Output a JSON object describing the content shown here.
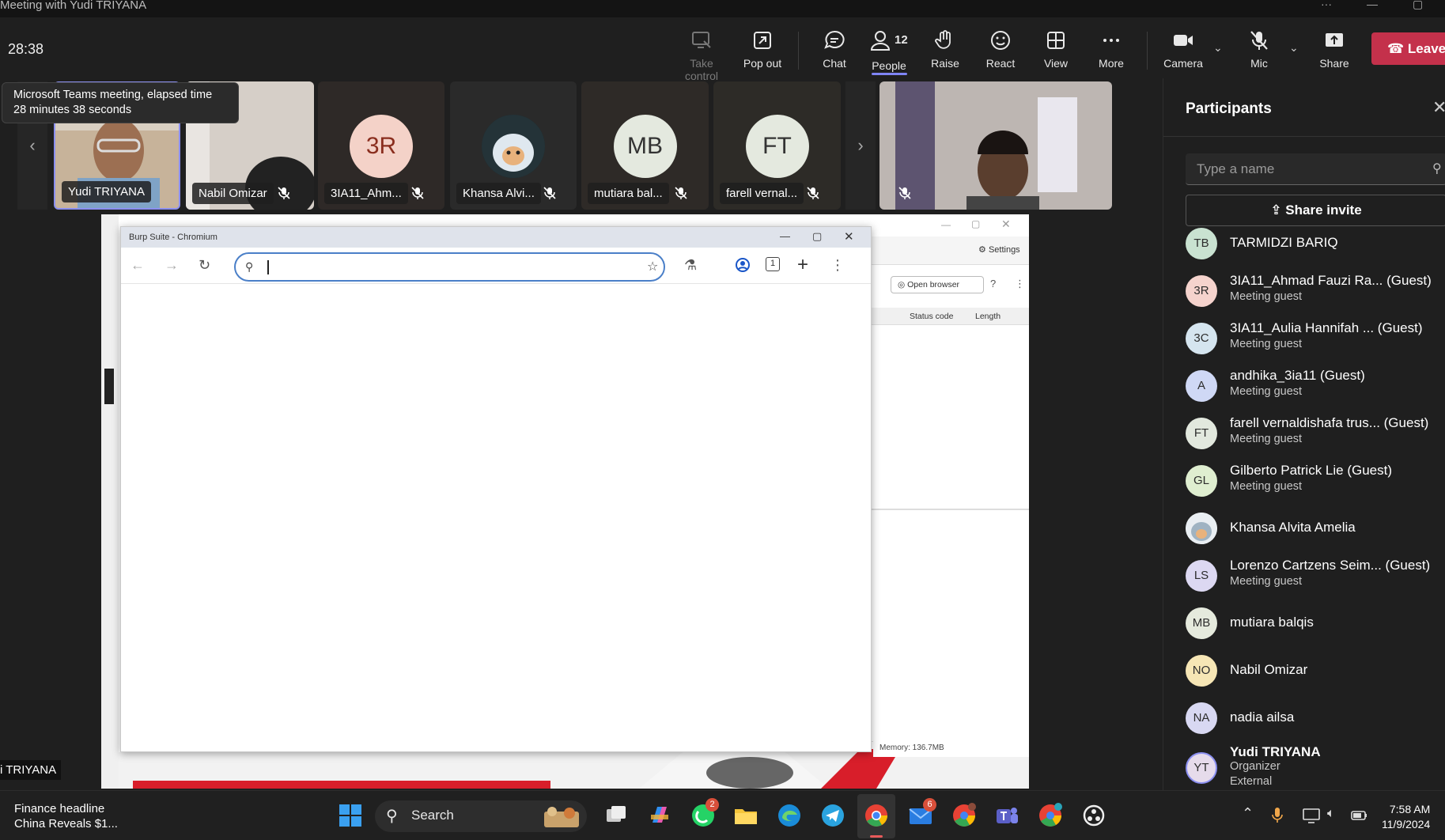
{
  "window": {
    "title": "Meeting with Yudi TRIYANA"
  },
  "toolbar": {
    "timer": "28:38",
    "take_control": "Take control",
    "pop_out": "Pop out",
    "chat": "Chat",
    "people": "People",
    "people_count": "12",
    "raise": "Raise",
    "react": "React",
    "view": "View",
    "more": "More",
    "camera": "Camera",
    "mic": "Mic",
    "share": "Share",
    "leave": "Leave"
  },
  "tooltip": {
    "line1": "Microsoft Teams meeting, elapsed time",
    "line2": "28 minutes 38 seconds"
  },
  "tiles": [
    {
      "name": "Yudi TRIYANA"
    },
    {
      "name": "Nabil Omizar"
    },
    {
      "initials": "3R",
      "name": "3IA11_Ahm..."
    },
    {
      "name": "Khansa Alvi..."
    },
    {
      "initials": "MB",
      "name": "mutiara bal..."
    },
    {
      "initials": "FT",
      "name": "farell vernal..."
    }
  ],
  "shared": {
    "chromium_title": "Burp Suite - Chromium",
    "settings": "Settings",
    "open_browser": "Open browser",
    "status_code": "Status code",
    "length": "Length",
    "memory": "Memory: 136.7MB",
    "tab_count": "1"
  },
  "caption": {
    "presenter": "i TRIYANA"
  },
  "panel": {
    "title": "Participants",
    "search_placeholder": "Type a name",
    "share_invite": "Share invite",
    "participants": [
      {
        "initials": "TB",
        "name": "TARMIDZI BARIQ",
        "sub": "",
        "color": "#c9e2d1"
      },
      {
        "initials": "3R",
        "name": "3IA11_Ahmad Fauzi Ra... (Guest)",
        "sub": "Meeting guest",
        "color": "#f5d3cd"
      },
      {
        "initials": "3C",
        "name": "3IA11_Aulia Hannifah ... (Guest)",
        "sub": "Meeting guest",
        "color": "#d5e5ef"
      },
      {
        "initials": "A",
        "name": "andhika_3ia11 (Guest)",
        "sub": "Meeting guest",
        "color": "#cfd8f5"
      },
      {
        "initials": "FT",
        "name": "farell vernaldishafa trus... (Guest)",
        "sub": "Meeting guest",
        "color": "#e2e8de"
      },
      {
        "initials": "GL",
        "name": "Gilberto Patrick Lie (Guest)",
        "sub": "Meeting guest",
        "color": "#dfeed0"
      },
      {
        "initials": "",
        "name": "Khansa Alvita Amelia",
        "sub": "",
        "color": "#ffffff"
      },
      {
        "initials": "LS",
        "name": "Lorenzo Cartzens Seim... (Guest)",
        "sub": "Meeting guest",
        "color": "#dcd8f2"
      },
      {
        "initials": "MB",
        "name": "mutiara balqis",
        "sub": "",
        "color": "#e5eadd"
      },
      {
        "initials": "NO",
        "name": "Nabil Omizar",
        "sub": "",
        "color": "#f6e6b5"
      },
      {
        "initials": "NA",
        "name": "nadia ailsa",
        "sub": "",
        "color": "#d8d8f2"
      },
      {
        "initials": "YT",
        "name": "Yudi TRIYANA",
        "sub": "Organizer",
        "sub2": "External",
        "color": "#e6dbeb"
      }
    ]
  },
  "taskbar": {
    "news_title": "Finance headline",
    "news_sub": "China Reveals $1...",
    "search": "Search",
    "whatsapp_badge": "2",
    "mail_badge": "6",
    "time": "7:58 AM",
    "date": "11/9/2024"
  }
}
